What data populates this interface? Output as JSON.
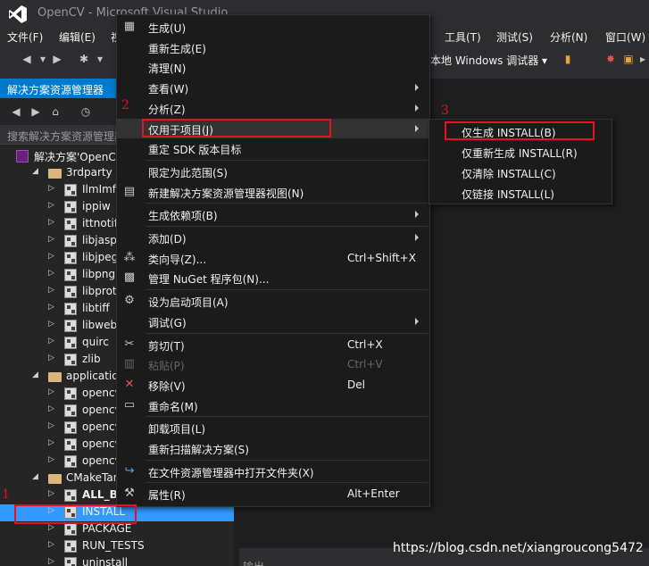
{
  "window": {
    "title": "OpenCV - Microsoft Visual Studio"
  },
  "menubar": {
    "items": [
      "文件(F)",
      "编辑(E)",
      "视",
      "工具(T)",
      "测试(S)",
      "分析(N)",
      "窗口(W)"
    ]
  },
  "toolbar": {
    "debugger": "本地 Windows 调试器 ▾"
  },
  "solution_explorer": {
    "title": "解决方案资源管理器",
    "search_placeholder": "搜索解决方案资源管理器",
    "tree": [
      {
        "label": "解决方案'OpenC",
        "type": "solution",
        "level": 0
      },
      {
        "label": "3rdparty",
        "type": "folder",
        "level": 1
      },
      {
        "label": "IlmImf",
        "type": "project",
        "level": 2
      },
      {
        "label": "ippiw",
        "type": "project",
        "level": 2
      },
      {
        "label": "ittnotify",
        "type": "project",
        "level": 2
      },
      {
        "label": "libjasper",
        "type": "project",
        "level": 2
      },
      {
        "label": "libjpeg-tu",
        "type": "project",
        "level": 2
      },
      {
        "label": "libpng",
        "type": "project",
        "level": 2
      },
      {
        "label": "libprotob",
        "type": "project",
        "level": 2
      },
      {
        "label": "libtiff",
        "type": "project",
        "level": 2
      },
      {
        "label": "libwebp",
        "type": "project",
        "level": 2
      },
      {
        "label": "quirc",
        "type": "project",
        "level": 2
      },
      {
        "label": "zlib",
        "type": "project",
        "level": 2
      },
      {
        "label": "applications",
        "type": "folder",
        "level": 1
      },
      {
        "label": "opencv_a",
        "type": "project",
        "level": 2
      },
      {
        "label": "opencv_ir",
        "type": "project",
        "level": 2
      },
      {
        "label": "opencv_ve",
        "type": "project",
        "level": 2
      },
      {
        "label": "opencv_ve",
        "type": "project",
        "level": 2
      },
      {
        "label": "opencv_vi",
        "type": "project",
        "level": 2
      },
      {
        "label": "CMakeTarge",
        "type": "folder",
        "level": 1
      },
      {
        "label": "ALL_BUIL",
        "type": "project",
        "level": 2,
        "bold": true
      },
      {
        "label": "INSTALL",
        "type": "project",
        "level": 2,
        "selected": true
      },
      {
        "label": "PACKAGE",
        "type": "project",
        "level": 2
      },
      {
        "label": "RUN_TESTS",
        "type": "project",
        "level": 2
      },
      {
        "label": "uninstall",
        "type": "project",
        "level": 2
      }
    ]
  },
  "context_menu": {
    "items": [
      {
        "label": "生成(U)",
        "icon": "build-icon"
      },
      {
        "label": "重新生成(E)"
      },
      {
        "label": "清理(N)"
      },
      {
        "label": "查看(W)",
        "submenu": true
      },
      {
        "label": "分析(Z)",
        "submenu": true
      },
      {
        "label": "仅用于项目(J)",
        "submenu": true,
        "highlighted": true
      },
      {
        "label": "重定 SDK 版本目标"
      },
      {
        "sep": true
      },
      {
        "label": "限定为此范围(S)"
      },
      {
        "label": "新建解决方案资源管理器视图(N)",
        "icon": "new-view-icon"
      },
      {
        "sep": true
      },
      {
        "label": "生成依赖项(B)",
        "submenu": true
      },
      {
        "sep": true
      },
      {
        "label": "添加(D)",
        "submenu": true
      },
      {
        "label": "类向导(Z)...",
        "shortcut": "Ctrl+Shift+X",
        "icon": "class-wizard-icon"
      },
      {
        "label": "管理 NuGet 程序包(N)...",
        "icon": "nuget-icon"
      },
      {
        "sep": true
      },
      {
        "label": "设为启动项目(A)",
        "icon": "gear-icon"
      },
      {
        "label": "调试(G)",
        "submenu": true
      },
      {
        "sep": true
      },
      {
        "label": "剪切(T)",
        "shortcut": "Ctrl+X",
        "icon": "scissors-icon"
      },
      {
        "label": "粘贴(P)",
        "shortcut": "Ctrl+V",
        "disabled": true,
        "icon": "paste-icon"
      },
      {
        "label": "移除(V)",
        "shortcut": "Del",
        "icon": "remove-icon"
      },
      {
        "label": "重命名(M)",
        "icon": "rename-icon"
      },
      {
        "sep": true
      },
      {
        "label": "卸载项目(L)"
      },
      {
        "label": "重新扫描解决方案(S)"
      },
      {
        "sep": true
      },
      {
        "label": "在文件资源管理器中打开文件夹(X)",
        "icon": "open-folder-icon"
      },
      {
        "sep": true
      },
      {
        "label": "属性(R)",
        "shortcut": "Alt+Enter",
        "icon": "wrench-icon"
      }
    ]
  },
  "submenu": {
    "items": [
      "仅生成 INSTALL(B)",
      "仅重新生成 INSTALL(R)",
      "仅清除 INSTALL(C)",
      "仅链接 INSTALL(L)"
    ]
  },
  "annotations": {
    "n1": "1",
    "n2": "2",
    "n3": "3"
  },
  "output_tab": "输出",
  "watermark": "https://blog.csdn.net/xiangroucong5472",
  "colors": {
    "accent": "#007acc",
    "selection": "#3399ff",
    "annotation": "#e81123"
  }
}
